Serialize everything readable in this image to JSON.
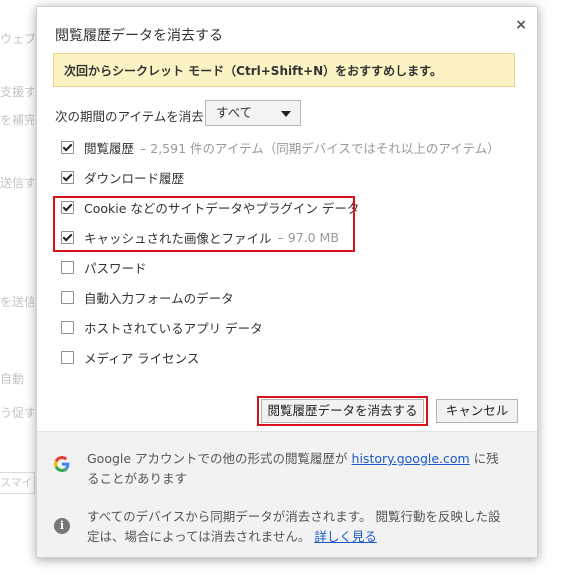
{
  "background": {
    "fragments": [
      "ウェブ",
      "支援す",
      "を補完",
      "送信す",
      "を送信",
      "自動",
      "う促す"
    ],
    "box_text": "スマイ"
  },
  "dialog": {
    "title": "閲覧履歴データを消去する",
    "close_glyph": "×",
    "notice": "次回からシークレット モード（Ctrl+Shift+N）をおすすめします。",
    "period_label": "次の期間のアイテムを消去:",
    "period_selected": "すべて",
    "items": [
      {
        "label": "閲覧履歴",
        "detail": "– 2,591 件のアイテム（同期デバイスではそれ以上のアイテム）",
        "checked": true
      },
      {
        "label": "ダウンロード履歴",
        "detail": "",
        "checked": true
      },
      {
        "label": "Cookie などのサイトデータやプラグイン データ",
        "detail": "",
        "checked": true
      },
      {
        "label": "キャッシュされた画像とファイル",
        "detail": "– 97.0 MB",
        "checked": true
      },
      {
        "label": "パスワード",
        "detail": "",
        "checked": false
      },
      {
        "label": "自動入力フォームのデータ",
        "detail": "",
        "checked": false
      },
      {
        "label": "ホストされているアプリ データ",
        "detail": "",
        "checked": false
      },
      {
        "label": "メディア ライセンス",
        "detail": "",
        "checked": false
      }
    ],
    "clear_button": "閲覧履歴データを消去する",
    "cancel_button": "キャンセル",
    "footer": {
      "google_prefix": "Google アカウントでの他の形式の閲覧履歴が ",
      "google_link": "history.google.com",
      "google_suffix": " に残ることがあります",
      "sync_text": "すべてのデバイスから同期データが消去されます。 閲覧行動を反映した設定は、場合によっては消去されません。 ",
      "sync_link": "詳しく見る"
    }
  },
  "colors": {
    "highlight": "#d8121c",
    "notice_bg": "#fbf3c4",
    "link": "#1a58c8",
    "google_blue": "#4285f4",
    "google_red": "#ea4335",
    "google_yellow": "#fbbc05",
    "google_green": "#34a853"
  },
  "icons": {
    "google": "google-g-icon",
    "info": "info-icon",
    "close": "close-icon",
    "dropdown": "chevron-down-icon"
  }
}
